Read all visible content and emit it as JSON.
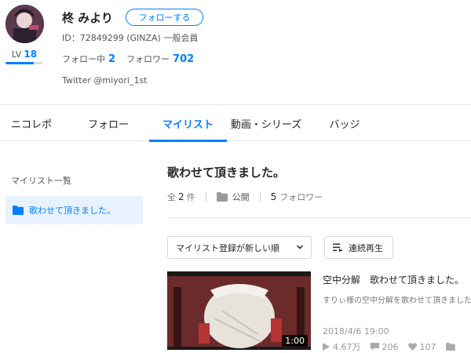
{
  "profile": {
    "name": "柊 みより",
    "follow_button": "フォローする",
    "id_line": "ID：72849299 (GINZA) 一般会員",
    "level_label": "LV",
    "level_value": "18",
    "level_progress": 0.75,
    "following_label": "フォロー中",
    "following_count": "2",
    "followers_label": "フォロワー",
    "followers_count": "702",
    "twitter": "Twitter @miyori_1st"
  },
  "tabs": [
    {
      "label": "ニコレポ",
      "active": false
    },
    {
      "label": "フォロー",
      "active": false
    },
    {
      "label": "マイリスト",
      "active": true
    },
    {
      "label": "動画・シリーズ",
      "active": false
    },
    {
      "label": "バッジ",
      "active": false
    }
  ],
  "sidebar": {
    "title": "マイリスト一覧",
    "items": [
      {
        "label": "歌わせて頂きました。",
        "selected": true,
        "icon": "folder-icon"
      }
    ]
  },
  "mylist": {
    "title": "歌わせて頂きました。",
    "count_prefix": "全",
    "count": "2",
    "count_suffix": "件",
    "visibility": "公開",
    "follower_count": "5",
    "follower_label": "フォロワー",
    "sort_label": "マイリスト登録が新しい順",
    "play_label": "連続再生"
  },
  "videos": [
    {
      "duration": "1:00",
      "title": "空中分解　歌わせて頂きました。",
      "description": "すりぃ様の空中分解を歌わせて頂きました。",
      "date": "2018/4/6 19:00",
      "views": "4.67万",
      "comments": "206",
      "likes": "107"
    }
  ],
  "colors": {
    "accent": "#0080ff",
    "selected_bg": "#e8f2ff",
    "text": "#252525",
    "muted": "#777777"
  }
}
